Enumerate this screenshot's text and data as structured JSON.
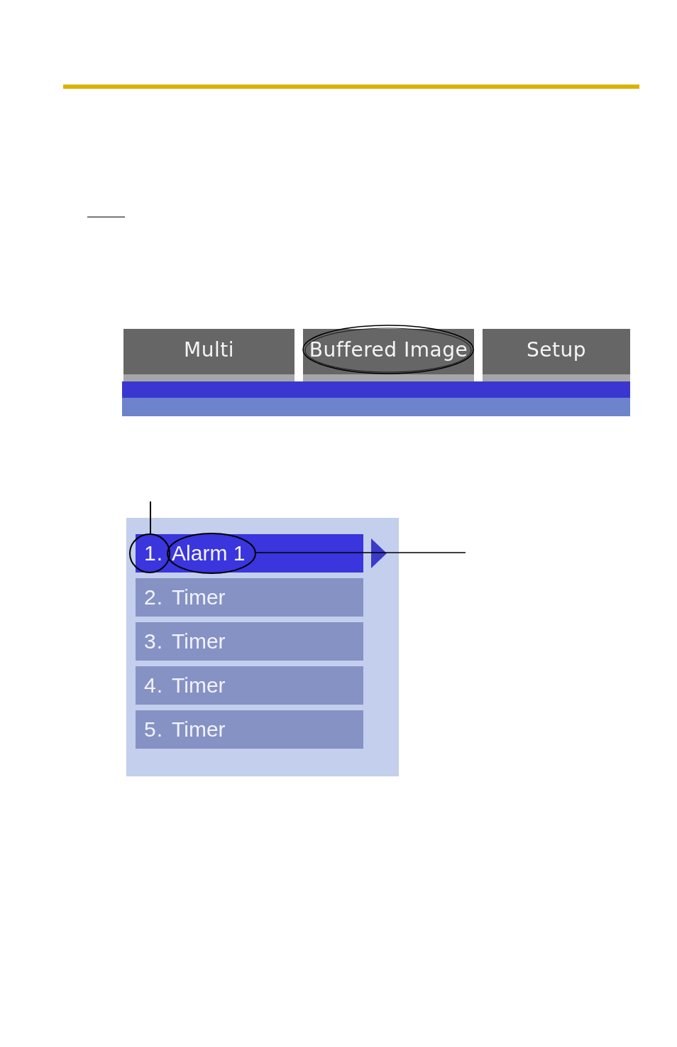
{
  "tabs": [
    {
      "label": "Multi"
    },
    {
      "label": "Buffered Image"
    },
    {
      "label": "Setup"
    }
  ],
  "menu": {
    "items": [
      {
        "number": "1.",
        "label": "Alarm 1",
        "selected": true
      },
      {
        "number": "2.",
        "label": "Timer",
        "selected": false
      },
      {
        "number": "3.",
        "label": "Timer",
        "selected": false
      },
      {
        "number": "4.",
        "label": "Timer",
        "selected": false
      },
      {
        "number": "5.",
        "label": "Timer",
        "selected": false
      }
    ]
  }
}
